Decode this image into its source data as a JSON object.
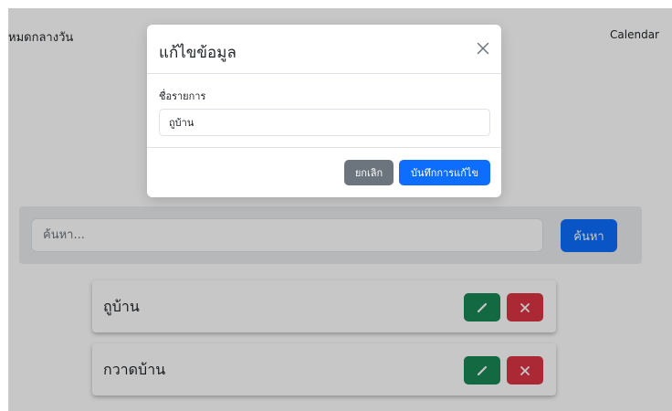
{
  "navbar": {
    "brand": "หมดกลางวัน",
    "calendar_link": "Calendar"
  },
  "search": {
    "placeholder": "ค้นหา...",
    "button_label": "ค้นหา"
  },
  "todo_list": {
    "items": [
      {
        "label": "ถูบ้าน"
      },
      {
        "label": "กวาดบ้าน"
      }
    ]
  },
  "edit_modal": {
    "title": "แก้ไขข้อมูล",
    "field_label": "ชื่อรายการ",
    "field_value": "ถูบ้าน",
    "cancel_label": "ยกเลิก",
    "save_label": "บันทึกการแก้ไข"
  },
  "icons": {
    "edit": "pencil-icon",
    "delete": "x-icon",
    "close": "close-icon"
  },
  "colors": {
    "primary": "#0d6efd",
    "success": "#198754",
    "danger": "#dc3545",
    "secondary": "#6c757d"
  }
}
